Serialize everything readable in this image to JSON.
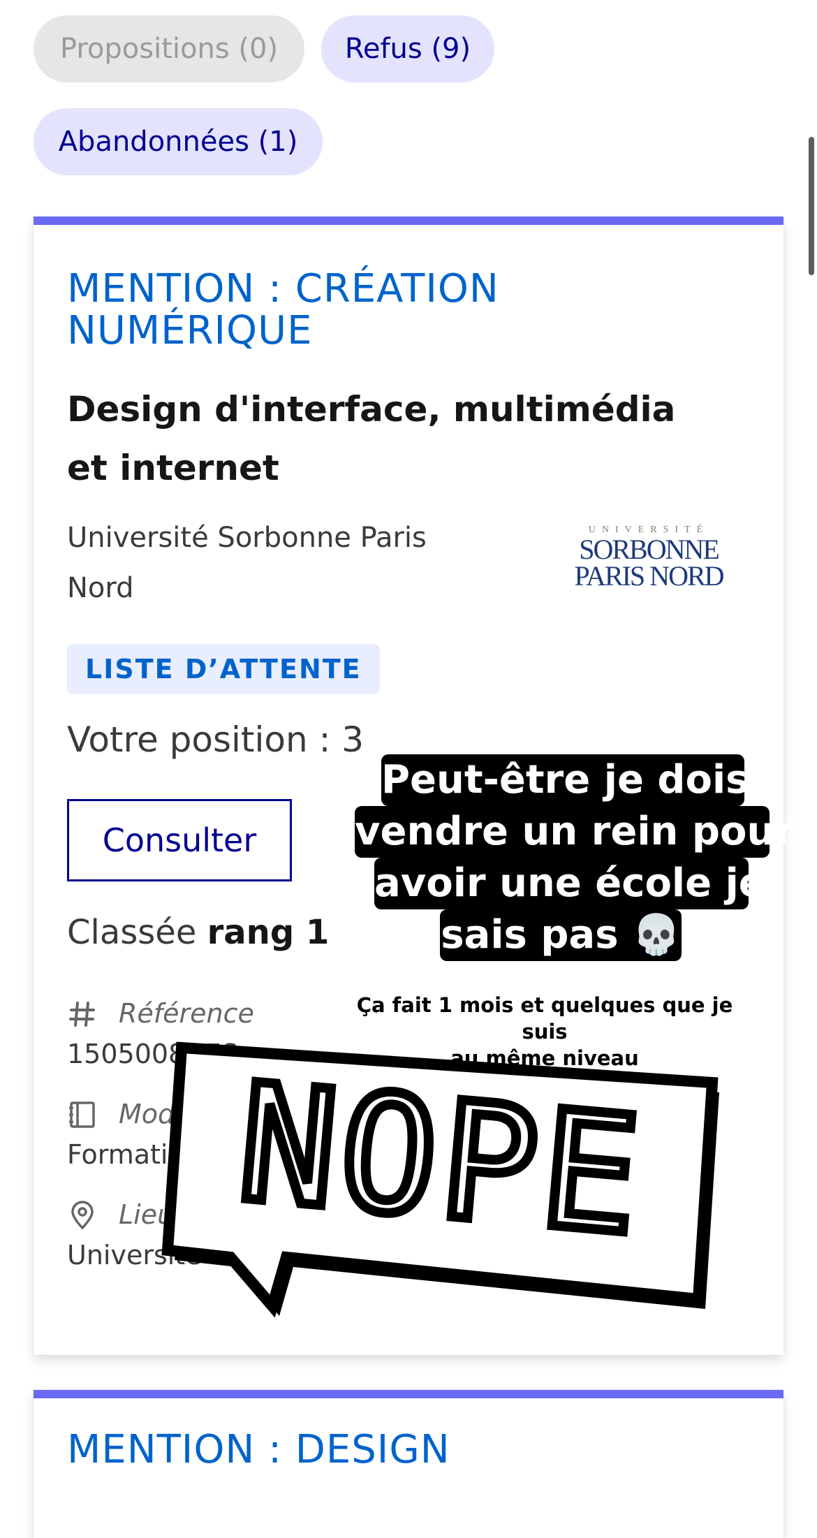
{
  "filters": {
    "propositions": "Propositions (0)",
    "refus": "Refus (9)",
    "abandonnees": "Abandonnées (1)"
  },
  "card": {
    "mention": [
      "MENTION : CRÉATION",
      "NUMÉRIQUE"
    ],
    "title": "Design d'interface, multimédia et internet",
    "university": "Université Sorbonne Paris Nord",
    "logo": {
      "top": "UNIVERSITÉ",
      "line1": "SORBONNE",
      "line2": "PARIS NORD"
    },
    "status_badge": "LISTE D’ATTENTE",
    "position_label": "Votre position : 3",
    "consult_label": "Consulter",
    "rank_prefix": "Classée",
    "rank_value": "rang 1",
    "reference_label": "Référence",
    "reference_value": "1505008UES",
    "modality_label": "Mod",
    "modality_value": "Formati",
    "location_label": "Lieu",
    "location_value": "Universite Sorb"
  },
  "next_card": {
    "mention": "MENTION : DESIGN"
  },
  "overlay": {
    "caption": [
      "Peut-être je dois",
      "vendre un rein pour",
      "avoir une école je",
      "sais pas 💀"
    ],
    "subcaption": [
      "Ça fait 1 mois et quelques que je suis",
      "au même niveau"
    ],
    "sticker_text": "NOPE"
  },
  "colors": {
    "primary_blue": "#000091",
    "link_blue": "#0063cb",
    "accent_bar": "#6a6af4",
    "chip_blue_bg": "#e3e3fd",
    "badge_bg": "#e8edff"
  }
}
